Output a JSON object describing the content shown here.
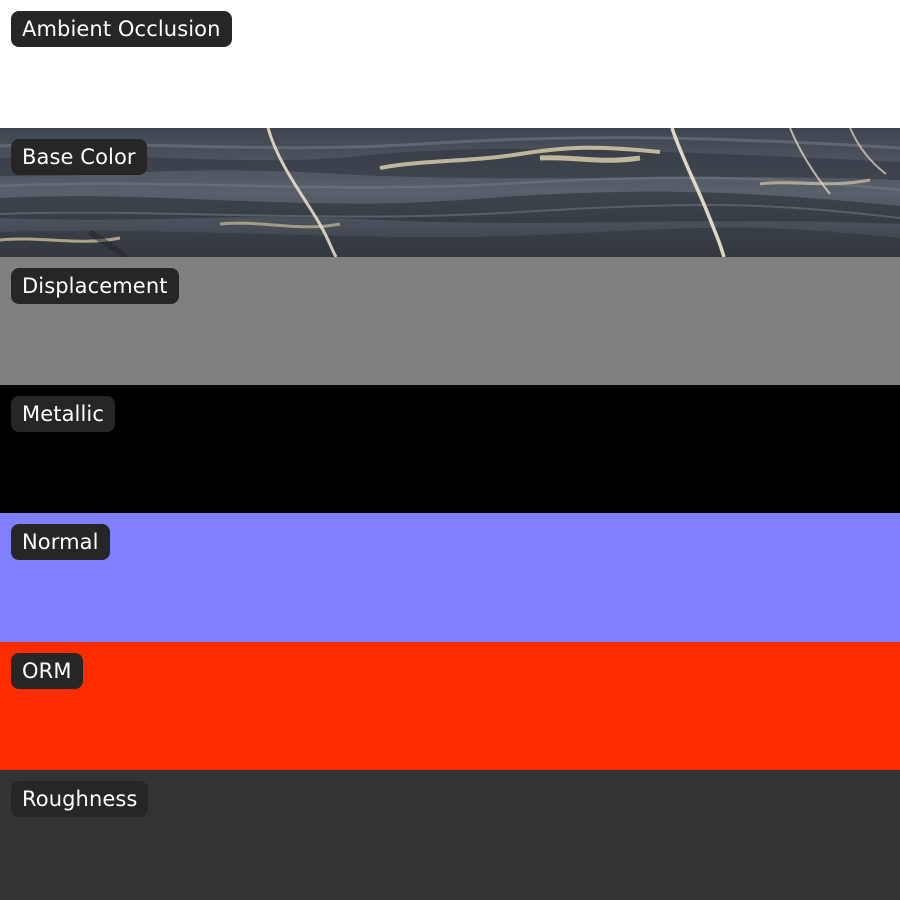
{
  "maps": [
    {
      "label": "Ambient Occlusion",
      "color": "#ffffff"
    },
    {
      "label": "Base Color",
      "color": "#4a5058",
      "texture": "veined-stone"
    },
    {
      "label": "Displacement",
      "color": "#808080"
    },
    {
      "label": "Metallic",
      "color": "#000000"
    },
    {
      "label": "Normal",
      "color": "#8080ff"
    },
    {
      "label": "ORM",
      "color": "#ff2c00"
    },
    {
      "label": "Roughness",
      "color": "#333333"
    }
  ]
}
